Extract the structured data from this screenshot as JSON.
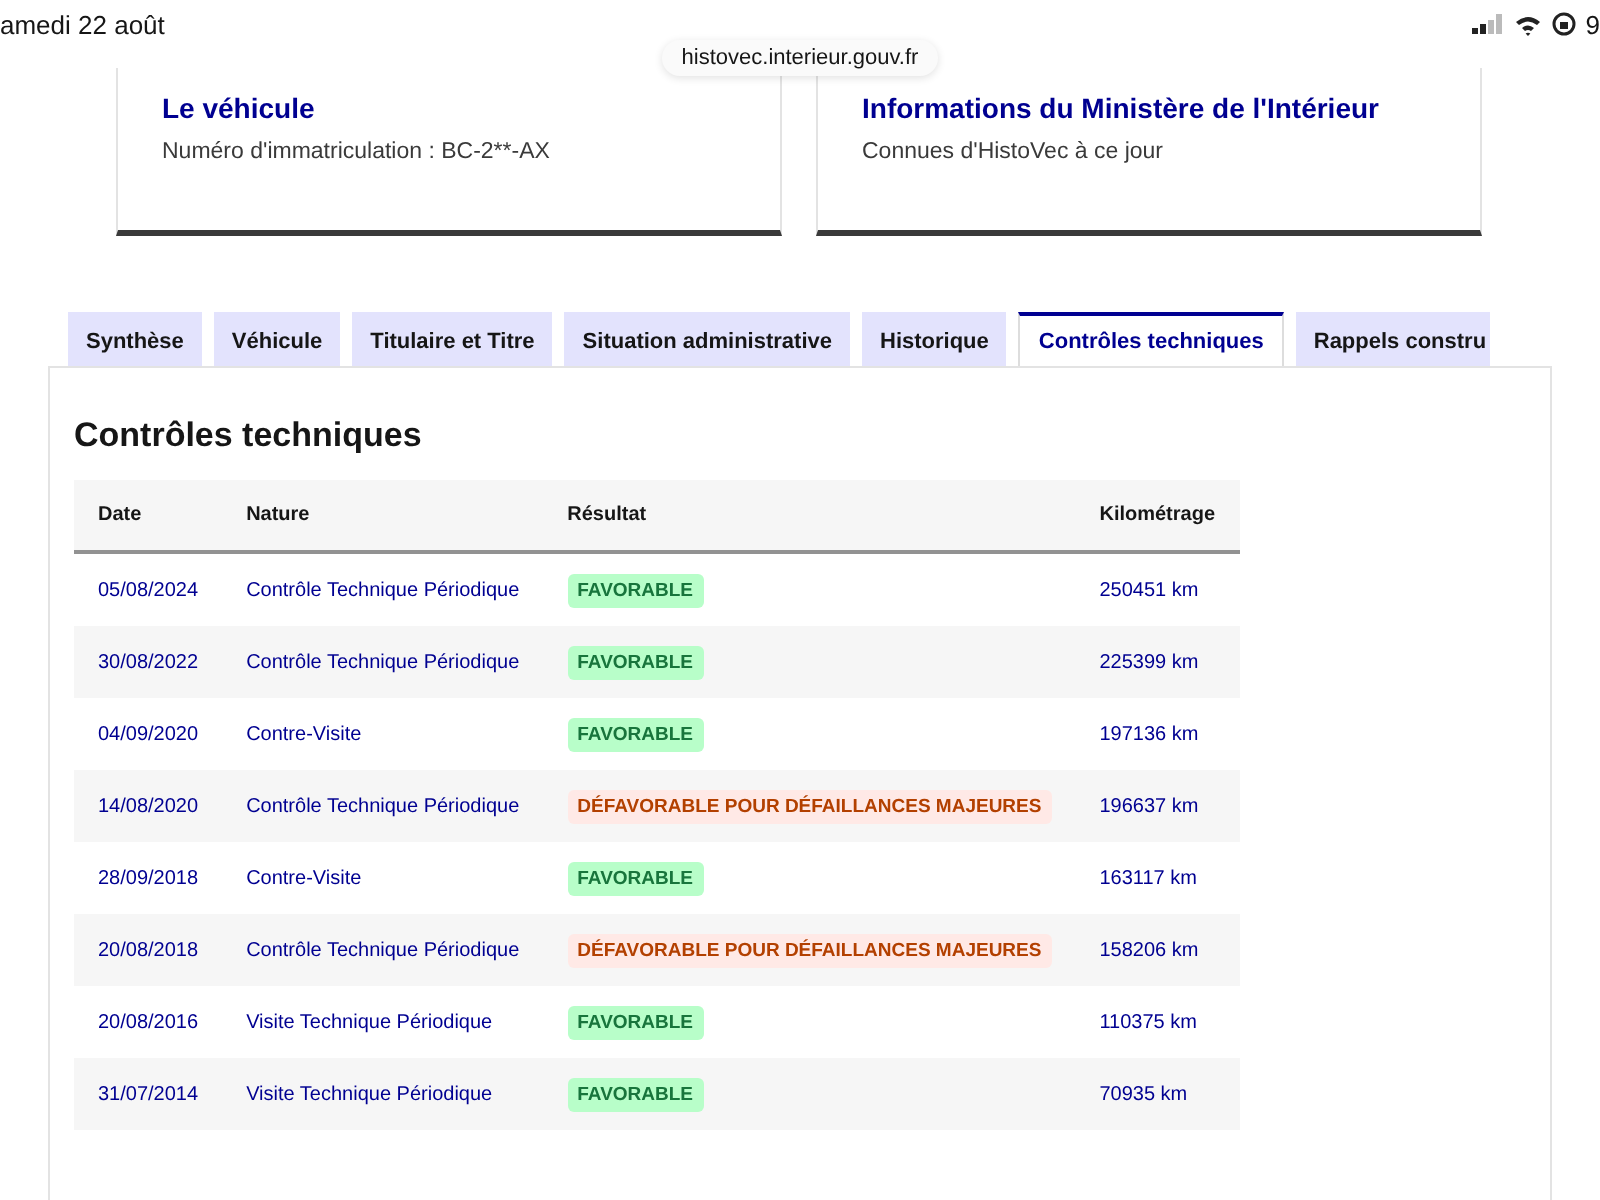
{
  "status_bar": {
    "date": "amedi 22 août",
    "battery_text": "9"
  },
  "url": "histovec.interieur.gouv.fr",
  "cards": [
    {
      "title": "Le véhicule",
      "text": "Numéro d'immatriculation : BC-2**-AX"
    },
    {
      "title": "Informations du Ministère de l'Intérieur",
      "text": "Connues d'HistoVec à ce jour"
    }
  ],
  "tabs": [
    {
      "label": "Synthèse",
      "selected": false
    },
    {
      "label": "Véhicule",
      "selected": false
    },
    {
      "label": "Titulaire et Titre",
      "selected": false
    },
    {
      "label": "Situation administrative",
      "selected": false
    },
    {
      "label": "Historique",
      "selected": false
    },
    {
      "label": "Contrôles techniques",
      "selected": true
    },
    {
      "label": "Rappels constru",
      "selected": false
    }
  ],
  "section_title": "Contrôles techniques",
  "table": {
    "columns": [
      "Date",
      "Nature",
      "Résultat",
      "Kilométrage"
    ],
    "rows": [
      {
        "date": "05/08/2024",
        "nature": "Contrôle Technique Périodique",
        "result": {
          "kind": "favorable",
          "label": "FAVORABLE"
        },
        "km": "250451 km"
      },
      {
        "date": "30/08/2022",
        "nature": "Contrôle Technique Périodique",
        "result": {
          "kind": "favorable",
          "label": "FAVORABLE"
        },
        "km": "225399 km"
      },
      {
        "date": "04/09/2020",
        "nature": "Contre-Visite",
        "result": {
          "kind": "favorable",
          "label": "FAVORABLE"
        },
        "km": "197136 km"
      },
      {
        "date": "14/08/2020",
        "nature": "Contrôle Technique Périodique",
        "result": {
          "kind": "defavorable",
          "label": "DÉFAVORABLE POUR DÉFAILLANCES MAJEURES"
        },
        "km": "196637 km"
      },
      {
        "date": "28/09/2018",
        "nature": "Contre-Visite",
        "result": {
          "kind": "favorable",
          "label": "FAVORABLE"
        },
        "km": "163117 km"
      },
      {
        "date": "20/08/2018",
        "nature": "Contrôle Technique Périodique",
        "result": {
          "kind": "defavorable",
          "label": "DÉFAVORABLE POUR DÉFAILLANCES MAJEURES"
        },
        "km": "158206 km"
      },
      {
        "date": "20/08/2016",
        "nature": "Visite Technique Périodique",
        "result": {
          "kind": "favorable",
          "label": "FAVORABLE"
        },
        "km": "110375 km"
      },
      {
        "date": "31/07/2014",
        "nature": "Visite Technique Périodique",
        "result": {
          "kind": "favorable",
          "label": "FAVORABLE"
        },
        "km": "70935 km"
      }
    ]
  }
}
